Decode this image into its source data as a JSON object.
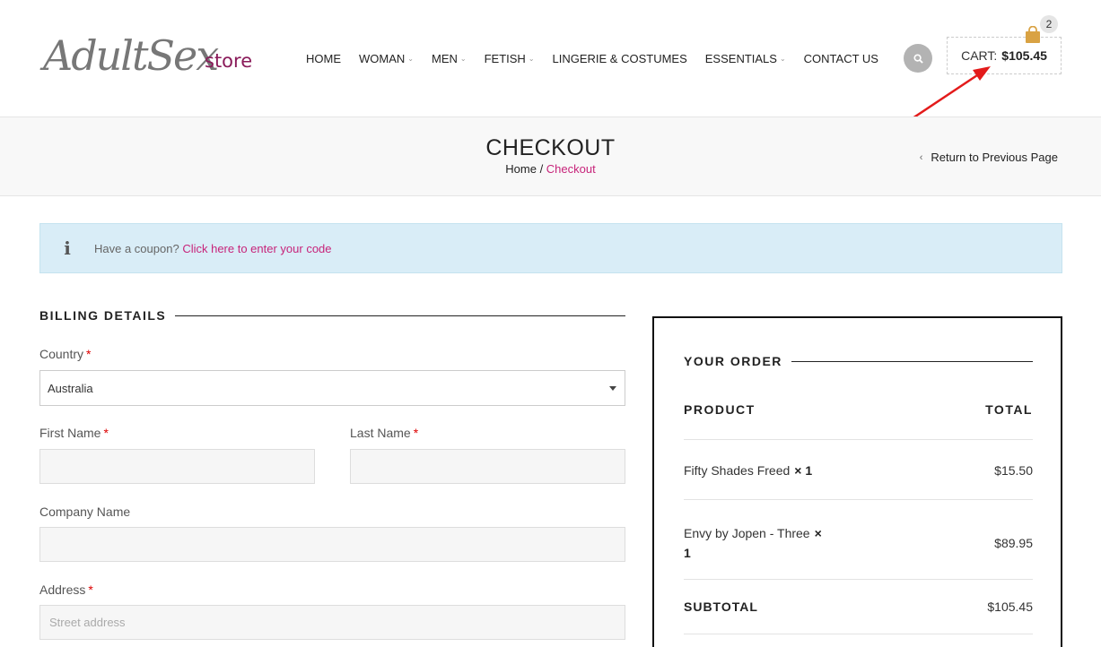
{
  "header": {
    "logo_script": "AdultSex",
    "logo_store": "store",
    "nav": [
      {
        "label": "HOME",
        "has_dropdown": false
      },
      {
        "label": "WOMAN",
        "has_dropdown": true
      },
      {
        "label": "MEN",
        "has_dropdown": true
      },
      {
        "label": "FETISH",
        "has_dropdown": true
      },
      {
        "label": "LINGERIE & COSTUMES",
        "has_dropdown": false
      },
      {
        "label": "ESSENTIALS",
        "has_dropdown": true
      },
      {
        "label": "CONTACT US",
        "has_dropdown": false
      }
    ],
    "search_icon": "search-icon",
    "cart": {
      "label": "CART:",
      "total": "$105.45",
      "count": "2",
      "icon": "shopping-bag-icon"
    }
  },
  "title_bar": {
    "title": "CHECKOUT",
    "breadcrumb_home": "Home",
    "breadcrumb_sep": " / ",
    "breadcrumb_current": "Checkout",
    "back_link": "Return to Previous Page"
  },
  "coupon": {
    "text": "Have a coupon?",
    "link": "Click here to enter your code",
    "icon": "info-icon"
  },
  "billing": {
    "heading": "BILLING DETAILS",
    "country_label": "Country",
    "country_value": "Australia",
    "first_name_label": "First Name",
    "last_name_label": "Last Name",
    "company_label": "Company Name",
    "address_label": "Address",
    "address_placeholder": "Street address",
    "required_mark": "*"
  },
  "order": {
    "heading": "YOUR ORDER",
    "col_product": "PRODUCT",
    "col_total": "TOTAL",
    "items": [
      {
        "name": "Fifty Shades Freed",
        "qty": "× 1",
        "total": "$15.50"
      },
      {
        "name": "Envy by Jopen - Three",
        "qty": "×",
        "qty2": "1",
        "total": "$89.95"
      }
    ],
    "subtotal_label": "SUBTOTAL",
    "subtotal_value": "$105.45"
  },
  "colors": {
    "accent": "#c7247a",
    "logo_store": "#8a1b5a",
    "coupon_bg": "#d9edf7",
    "arrow": "#e31b1b",
    "cart_bag": "#d9a243"
  }
}
